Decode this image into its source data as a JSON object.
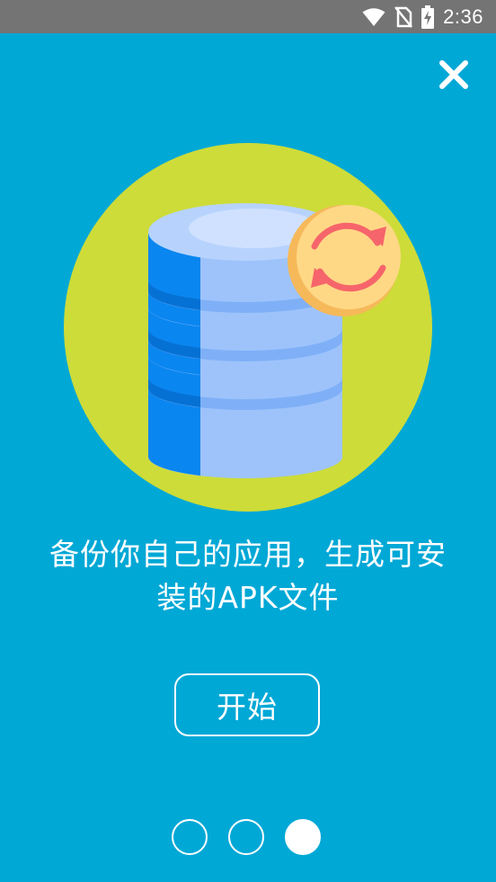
{
  "status_bar": {
    "time": "2:36",
    "icons": [
      "wifi-icon",
      "no-sim-icon",
      "battery-charging-icon"
    ]
  },
  "close_icon": "close-icon",
  "illustration": {
    "name": "database-sync-illustration",
    "colors": {
      "circle": "#cddc39",
      "cylinder_light": "#9ec3fb",
      "cylinder_dark": "#0a86f0",
      "sync_badge": "#ffd886",
      "sync_arrows": "#f6656b"
    }
  },
  "headline": {
    "line1": "备份你自己的应用，生成可安",
    "line2": "装的APK文件"
  },
  "start_button": {
    "label": "开始"
  },
  "pager": {
    "pages": 3,
    "active_index": 2
  },
  "colors": {
    "background": "#00a8d6",
    "status_bar": "#747474",
    "text": "#ffffff"
  }
}
